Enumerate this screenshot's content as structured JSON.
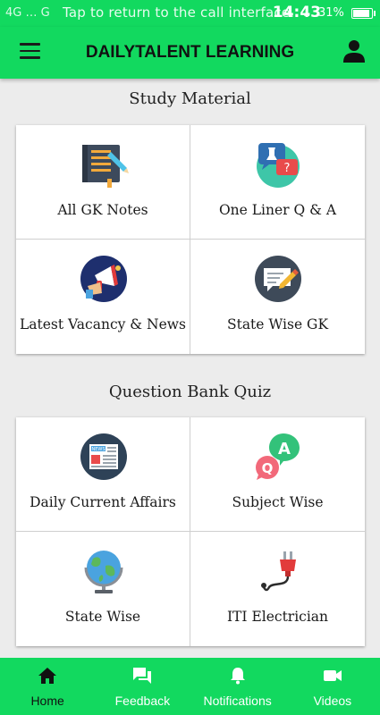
{
  "status_bar": {
    "left": "4G … G",
    "overlay_text": "Tap to return to the call interface.",
    "clock": "14:43",
    "right": "… 31%"
  },
  "app_bar": {
    "title": "DAILYTALENT LEARNING"
  },
  "sections": [
    {
      "title": "Study Material",
      "tiles": [
        {
          "label": "All GK Notes",
          "icon": "notebook-icon"
        },
        {
          "label": "One Liner Q & A",
          "icon": "qa-bubble-icon"
        },
        {
          "label": "Latest Vacancy & News",
          "icon": "megaphone-icon"
        },
        {
          "label": "State Wise GK",
          "icon": "message-edit-icon"
        }
      ]
    },
    {
      "title": "Question Bank Quiz",
      "tiles": [
        {
          "label": "Daily Current Affairs",
          "icon": "newspaper-icon"
        },
        {
          "label": "Subject Wise",
          "icon": "qa-letters-icon"
        },
        {
          "label": "State Wise",
          "icon": "globe-icon"
        },
        {
          "label": "ITI Electrician",
          "icon": "plug-icon"
        }
      ]
    }
  ],
  "bottom_nav": [
    {
      "label": "Home",
      "icon": "home-icon",
      "active": true
    },
    {
      "label": "Feedback",
      "icon": "chat-icon",
      "active": false
    },
    {
      "label": "Notifications",
      "icon": "bell-icon",
      "active": false
    },
    {
      "label": "Videos",
      "icon": "video-camera-icon",
      "active": false
    }
  ],
  "colors": {
    "primary": "#12d95f",
    "background": "#ececec",
    "card": "#ffffff",
    "text_dark": "#111111"
  }
}
